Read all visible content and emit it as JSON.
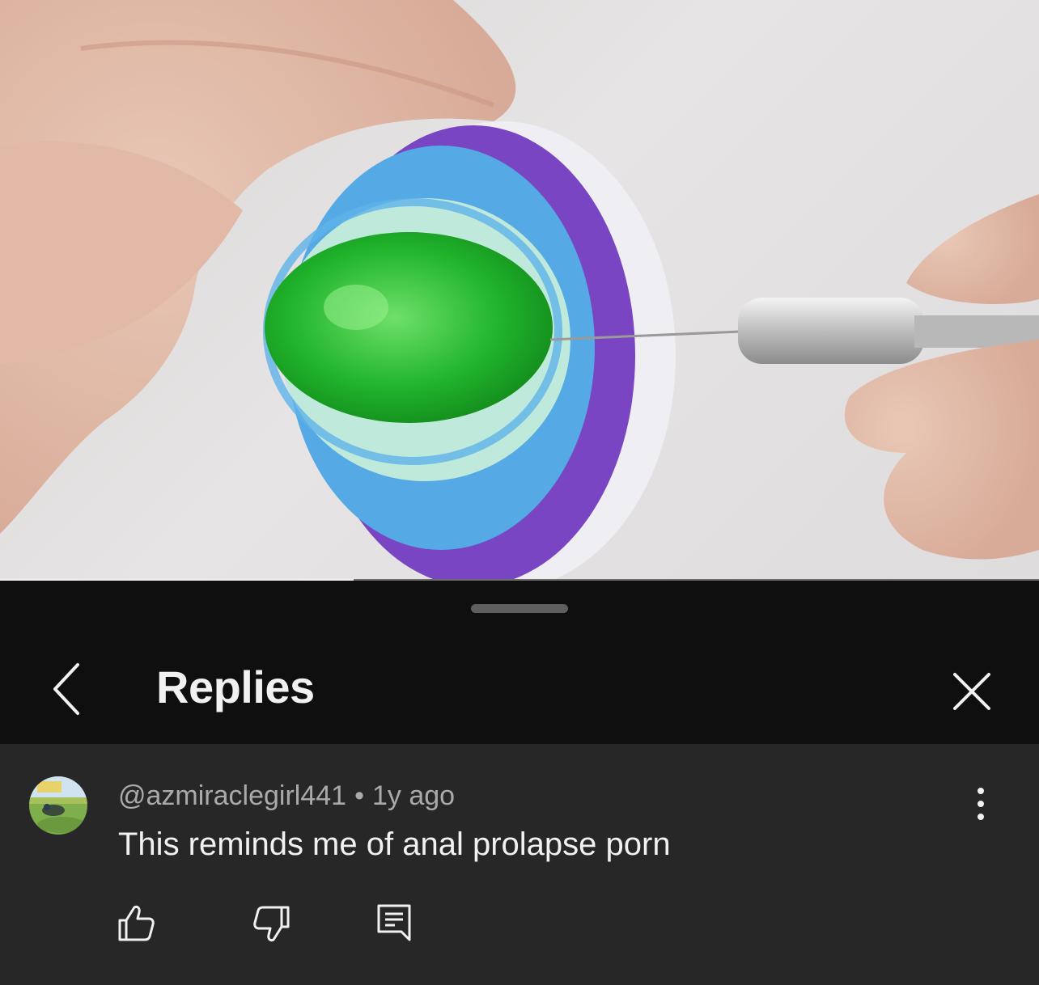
{
  "video": {
    "progress": 0.34
  },
  "sheet": {
    "title": "Replies"
  },
  "comment": {
    "author": "@azmiraclegirl441",
    "separator": "•",
    "time": "1y ago",
    "text": "This reminds me of anal prolapse porn"
  },
  "icons": {
    "back": "chevron-left-icon",
    "close": "close-icon",
    "more": "more-vertical-icon",
    "like": "thumbs-up-icon",
    "dislike": "thumbs-down-icon",
    "reply": "reply-comment-icon"
  },
  "colors": {
    "sheet_background": "#0f0f0f",
    "comment_background": "#272727",
    "text_primary": "#f1f1f1",
    "text_secondary": "#aaaaaa"
  }
}
